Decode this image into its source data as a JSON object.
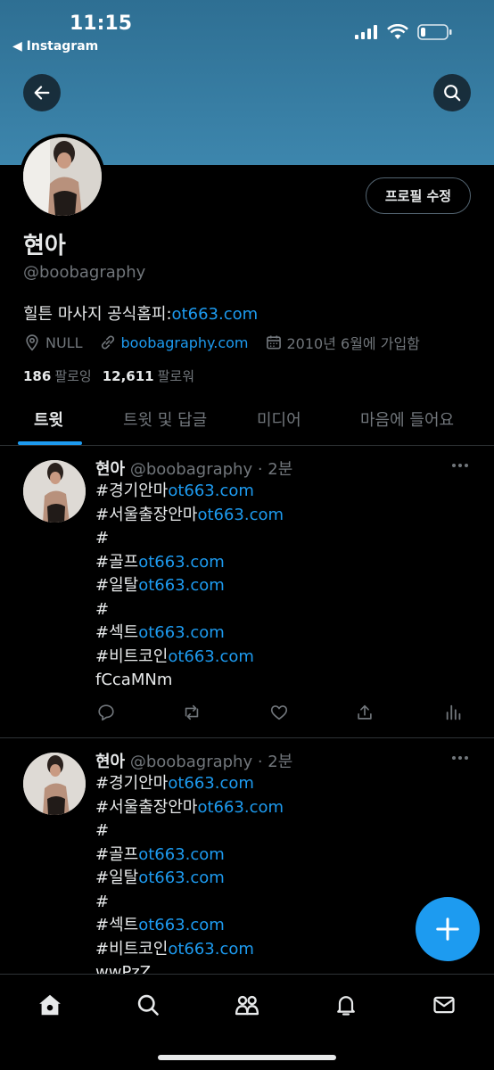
{
  "status_bar": {
    "time": "11:15",
    "back_app": "◀ Instagram"
  },
  "profile": {
    "edit_label": "프로필 수정",
    "name": "현아",
    "handle": "@boobagraphy",
    "bio_text": "힐튼 마사지 공식홈피:",
    "bio_link": "ot663.com",
    "location": "NULL",
    "website": "boobagraphy.com",
    "joined": "2010년 6월에 가입함",
    "following_count": "186",
    "following_label": "팔로잉",
    "followers_count": "12,611",
    "followers_label": "팔로워"
  },
  "tabs": [
    "트윗",
    "트윗 및 답글",
    "미디어",
    "마음에 들어요"
  ],
  "tweets": [
    {
      "name": "현아",
      "handle": "@boobagraphy",
      "sep": " · ",
      "time": "2분",
      "lines": [
        [
          "#경기안마",
          "ot663.com"
        ],
        [
          "#서울출장안마",
          "ot663.com"
        ],
        [
          "#",
          ""
        ],
        [
          "#골프",
          "ot663.com"
        ],
        [
          "#일탈",
          "ot663.com"
        ],
        [
          "#",
          ""
        ],
        [
          "#섹트",
          "ot663.com"
        ],
        [
          "#비트코인",
          "ot663.com"
        ],
        [
          "fCcaMNm",
          ""
        ]
      ]
    },
    {
      "name": "현아",
      "handle": "@boobagraphy",
      "sep": " · ",
      "time": "2분",
      "lines": [
        [
          "#경기안마",
          "ot663.com"
        ],
        [
          "#서울출장안마",
          "ot663.com"
        ],
        [
          "#",
          ""
        ],
        [
          "#골프",
          "ot663.com"
        ],
        [
          "#일탈",
          "ot663.com"
        ],
        [
          "#",
          ""
        ],
        [
          "#섹트",
          "ot663.com"
        ],
        [
          "#비트코인",
          "ot663.com"
        ],
        [
          "wwPzZ",
          ""
        ]
      ]
    }
  ],
  "icons": {
    "back": "arrow-left-icon",
    "search": "search-icon",
    "location": "location-pin-icon",
    "website": "link-icon",
    "joined": "calendar-icon",
    "reply": "reply-icon",
    "retweet": "retweet-icon",
    "like": "heart-icon",
    "share": "share-icon",
    "analytics": "analytics-icon",
    "compose": "plus-icon",
    "nav": [
      "home-icon",
      "search-icon",
      "communities-icon",
      "bell-icon",
      "mail-icon"
    ]
  },
  "colors": {
    "accent": "#1d9bf0",
    "background": "#000000",
    "banner": "#3d86ad",
    "muted": "#71767b"
  }
}
